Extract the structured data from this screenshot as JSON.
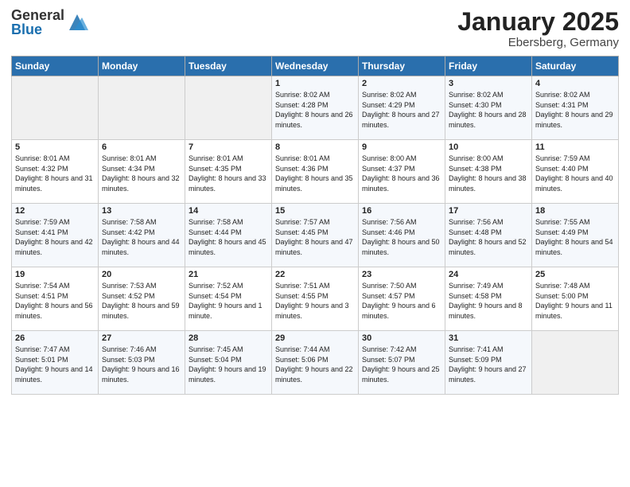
{
  "logo": {
    "general": "General",
    "blue": "Blue"
  },
  "title": "January 2025",
  "location": "Ebersberg, Germany",
  "weekdays": [
    "Sunday",
    "Monday",
    "Tuesday",
    "Wednesday",
    "Thursday",
    "Friday",
    "Saturday"
  ],
  "weeks": [
    [
      {
        "day": "",
        "info": ""
      },
      {
        "day": "",
        "info": ""
      },
      {
        "day": "",
        "info": ""
      },
      {
        "day": "1",
        "info": "Sunrise: 8:02 AM\nSunset: 4:28 PM\nDaylight: 8 hours and 26 minutes."
      },
      {
        "day": "2",
        "info": "Sunrise: 8:02 AM\nSunset: 4:29 PM\nDaylight: 8 hours and 27 minutes."
      },
      {
        "day": "3",
        "info": "Sunrise: 8:02 AM\nSunset: 4:30 PM\nDaylight: 8 hours and 28 minutes."
      },
      {
        "day": "4",
        "info": "Sunrise: 8:02 AM\nSunset: 4:31 PM\nDaylight: 8 hours and 29 minutes."
      }
    ],
    [
      {
        "day": "5",
        "info": "Sunrise: 8:01 AM\nSunset: 4:32 PM\nDaylight: 8 hours and 31 minutes."
      },
      {
        "day": "6",
        "info": "Sunrise: 8:01 AM\nSunset: 4:34 PM\nDaylight: 8 hours and 32 minutes."
      },
      {
        "day": "7",
        "info": "Sunrise: 8:01 AM\nSunset: 4:35 PM\nDaylight: 8 hours and 33 minutes."
      },
      {
        "day": "8",
        "info": "Sunrise: 8:01 AM\nSunset: 4:36 PM\nDaylight: 8 hours and 35 minutes."
      },
      {
        "day": "9",
        "info": "Sunrise: 8:00 AM\nSunset: 4:37 PM\nDaylight: 8 hours and 36 minutes."
      },
      {
        "day": "10",
        "info": "Sunrise: 8:00 AM\nSunset: 4:38 PM\nDaylight: 8 hours and 38 minutes."
      },
      {
        "day": "11",
        "info": "Sunrise: 7:59 AM\nSunset: 4:40 PM\nDaylight: 8 hours and 40 minutes."
      }
    ],
    [
      {
        "day": "12",
        "info": "Sunrise: 7:59 AM\nSunset: 4:41 PM\nDaylight: 8 hours and 42 minutes."
      },
      {
        "day": "13",
        "info": "Sunrise: 7:58 AM\nSunset: 4:42 PM\nDaylight: 8 hours and 44 minutes."
      },
      {
        "day": "14",
        "info": "Sunrise: 7:58 AM\nSunset: 4:44 PM\nDaylight: 8 hours and 45 minutes."
      },
      {
        "day": "15",
        "info": "Sunrise: 7:57 AM\nSunset: 4:45 PM\nDaylight: 8 hours and 47 minutes."
      },
      {
        "day": "16",
        "info": "Sunrise: 7:56 AM\nSunset: 4:46 PM\nDaylight: 8 hours and 50 minutes."
      },
      {
        "day": "17",
        "info": "Sunrise: 7:56 AM\nSunset: 4:48 PM\nDaylight: 8 hours and 52 minutes."
      },
      {
        "day": "18",
        "info": "Sunrise: 7:55 AM\nSunset: 4:49 PM\nDaylight: 8 hours and 54 minutes."
      }
    ],
    [
      {
        "day": "19",
        "info": "Sunrise: 7:54 AM\nSunset: 4:51 PM\nDaylight: 8 hours and 56 minutes."
      },
      {
        "day": "20",
        "info": "Sunrise: 7:53 AM\nSunset: 4:52 PM\nDaylight: 8 hours and 59 minutes."
      },
      {
        "day": "21",
        "info": "Sunrise: 7:52 AM\nSunset: 4:54 PM\nDaylight: 9 hours and 1 minute."
      },
      {
        "day": "22",
        "info": "Sunrise: 7:51 AM\nSunset: 4:55 PM\nDaylight: 9 hours and 3 minutes."
      },
      {
        "day": "23",
        "info": "Sunrise: 7:50 AM\nSunset: 4:57 PM\nDaylight: 9 hours and 6 minutes."
      },
      {
        "day": "24",
        "info": "Sunrise: 7:49 AM\nSunset: 4:58 PM\nDaylight: 9 hours and 8 minutes."
      },
      {
        "day": "25",
        "info": "Sunrise: 7:48 AM\nSunset: 5:00 PM\nDaylight: 9 hours and 11 minutes."
      }
    ],
    [
      {
        "day": "26",
        "info": "Sunrise: 7:47 AM\nSunset: 5:01 PM\nDaylight: 9 hours and 14 minutes."
      },
      {
        "day": "27",
        "info": "Sunrise: 7:46 AM\nSunset: 5:03 PM\nDaylight: 9 hours and 16 minutes."
      },
      {
        "day": "28",
        "info": "Sunrise: 7:45 AM\nSunset: 5:04 PM\nDaylight: 9 hours and 19 minutes."
      },
      {
        "day": "29",
        "info": "Sunrise: 7:44 AM\nSunset: 5:06 PM\nDaylight: 9 hours and 22 minutes."
      },
      {
        "day": "30",
        "info": "Sunrise: 7:42 AM\nSunset: 5:07 PM\nDaylight: 9 hours and 25 minutes."
      },
      {
        "day": "31",
        "info": "Sunrise: 7:41 AM\nSunset: 5:09 PM\nDaylight: 9 hours and 27 minutes."
      },
      {
        "day": "",
        "info": ""
      }
    ]
  ]
}
